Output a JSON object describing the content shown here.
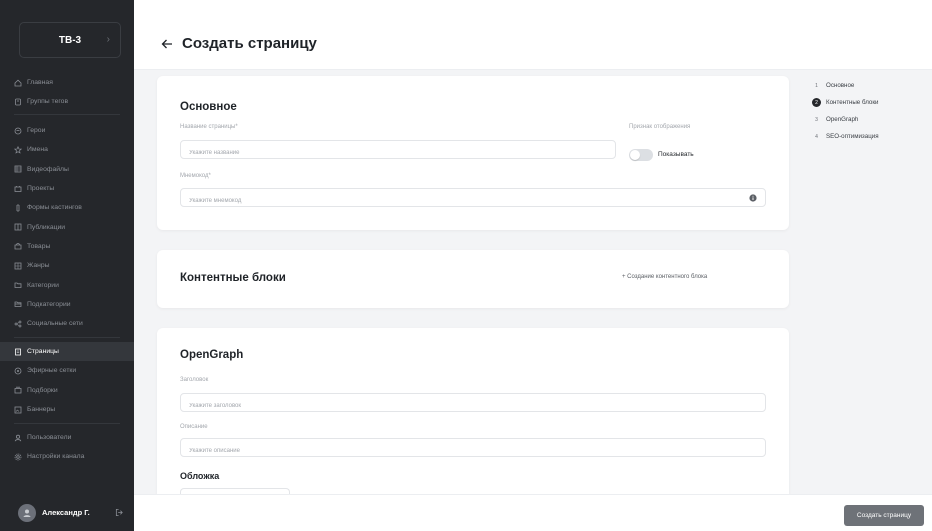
{
  "brand": {
    "name": "ТВ-3"
  },
  "sidebar": {
    "group1": [
      {
        "label": "Главная",
        "icon": "home-icon"
      },
      {
        "label": "Группы тегов",
        "icon": "tag-group-icon"
      }
    ],
    "group2": [
      {
        "label": "Герои",
        "icon": "hero-icon"
      },
      {
        "label": "Имена",
        "icon": "star-icon"
      },
      {
        "label": "Видеофайлы",
        "icon": "video-icon"
      },
      {
        "label": "Проекты",
        "icon": "project-icon"
      },
      {
        "label": "Формы кастингов",
        "icon": "form-icon"
      },
      {
        "label": "Публикации",
        "icon": "publication-icon"
      },
      {
        "label": "Товары",
        "icon": "product-icon"
      },
      {
        "label": "Жанры",
        "icon": "genre-icon"
      },
      {
        "label": "Категории",
        "icon": "folder-icon"
      },
      {
        "label": "Подкатегории",
        "icon": "subfolder-icon"
      },
      {
        "label": "Социальные сети",
        "icon": "share-icon"
      }
    ],
    "group3": [
      {
        "label": "Страницы",
        "icon": "page-icon",
        "active": true
      },
      {
        "label": "Эфирные сетки",
        "icon": "broadcast-icon"
      },
      {
        "label": "Подборки",
        "icon": "collection-icon"
      },
      {
        "label": "Баннеры",
        "icon": "banner-icon"
      }
    ],
    "group4": [
      {
        "label": "Пользователи",
        "icon": "user-icon"
      },
      {
        "label": "Настройки канала",
        "icon": "gear-icon"
      }
    ]
  },
  "user": {
    "name": "Александр Г."
  },
  "header": {
    "title": "Создать страницу"
  },
  "basic": {
    "title": "Основное",
    "name_label": "Название страницы*",
    "name_placeholder": "Укажите название",
    "display_label": "Признак отображения",
    "display_toggle_label": "Показывать",
    "display_on": false,
    "mnemo_label": "Мнемокод*",
    "mnemo_placeholder": "Укажите мнемокод"
  },
  "content": {
    "title": "Контентные блоки",
    "add_label": "+ Создание контентного блока"
  },
  "og": {
    "title": "OpenGraph",
    "heading_label": "Заголовок",
    "heading_placeholder": "Укажите заголовок",
    "desc_label": "Описание",
    "desc_placeholder": "Укажите описание",
    "cover_label": "Обложка"
  },
  "steps": [
    {
      "num": "1",
      "label": "Основное"
    },
    {
      "num": "2",
      "label": "Контентные блоки",
      "active": true
    },
    {
      "num": "3",
      "label": "OpenGraph"
    },
    {
      "num": "4",
      "label": "SEO-оптимизация"
    }
  ],
  "footer": {
    "submit_label": "Создать страницу"
  },
  "colors": {
    "sidebar_bg": "#25272b",
    "active_bg": "#34373c",
    "button_bg": "#6e7278"
  }
}
